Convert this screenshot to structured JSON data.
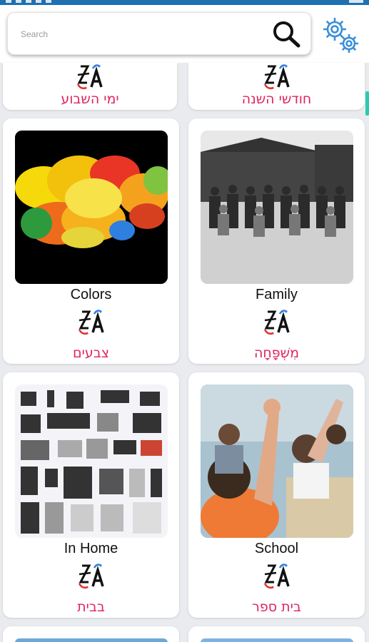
{
  "search": {
    "placeholder": "Search",
    "value": ""
  },
  "categories": [
    {
      "en": "",
      "he": "ימי השבוע"
    },
    {
      "en": "",
      "he": "חודשי השנה"
    },
    {
      "en": "Colors",
      "he": "צבעים"
    },
    {
      "en": "Family",
      "he": "מִשְׁפָּחָה"
    },
    {
      "en": "In Home",
      "he": "בבית"
    },
    {
      "en": "School",
      "he": "בית ספר"
    }
  ],
  "colors": {
    "accent_text": "#e0245e",
    "status_bar": "#1f6fb3",
    "scroll_indicator": "#2cc9b0"
  },
  "icons": [
    "search-icon",
    "gear-icon",
    "app-logo-icon"
  ]
}
